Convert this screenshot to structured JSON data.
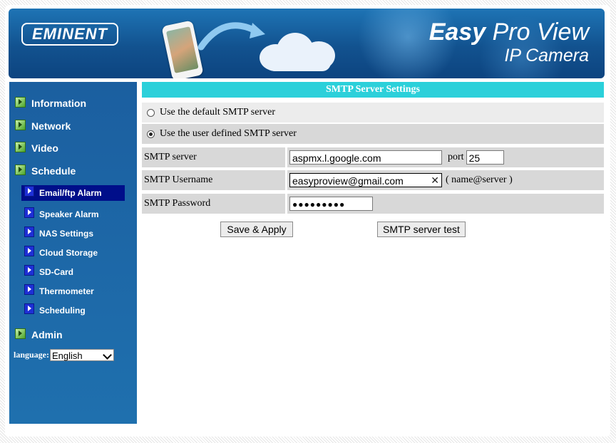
{
  "header": {
    "logo_text": "EMINENT",
    "brand_easy": "Easy",
    "brand_proview": "Pro View",
    "brand_subtitle": "IP Camera"
  },
  "sidebar": {
    "main_items": [
      {
        "label": "Information"
      },
      {
        "label": "Network"
      },
      {
        "label": "Video"
      },
      {
        "label": "Schedule"
      }
    ],
    "sub_items": [
      {
        "label": "Email/ftp Alarm",
        "active": true
      },
      {
        "label": "Speaker Alarm"
      },
      {
        "label": "NAS Settings"
      },
      {
        "label": "Cloud Storage"
      },
      {
        "label": "SD-Card"
      },
      {
        "label": "Thermometer"
      },
      {
        "label": "Scheduling"
      }
    ],
    "admin_label": "Admin",
    "language_label": "language:",
    "language_value": "English"
  },
  "main": {
    "section_title": "SMTP Server Settings",
    "radio_default_label": "Use the default SMTP server",
    "radio_user_label": "Use the user defined SMTP server",
    "smtp_server_label": "SMTP server",
    "smtp_server_value": "aspmx.l.google.com",
    "port_label": "port",
    "port_value": "25",
    "smtp_username_label": "SMTP Username",
    "smtp_username_value": "easyproview@gmail.com",
    "username_hint": "( name@server )",
    "smtp_password_label": "SMTP Password",
    "smtp_password_value": "●●●●●●●●●",
    "save_button": "Save & Apply",
    "test_button": "SMTP server test"
  },
  "colors": {
    "sidebar_bg": "#1f6aa8",
    "title_bar": "#2bd0da",
    "active_item": "#000e8a",
    "row_gray": "#d8d8d8"
  }
}
